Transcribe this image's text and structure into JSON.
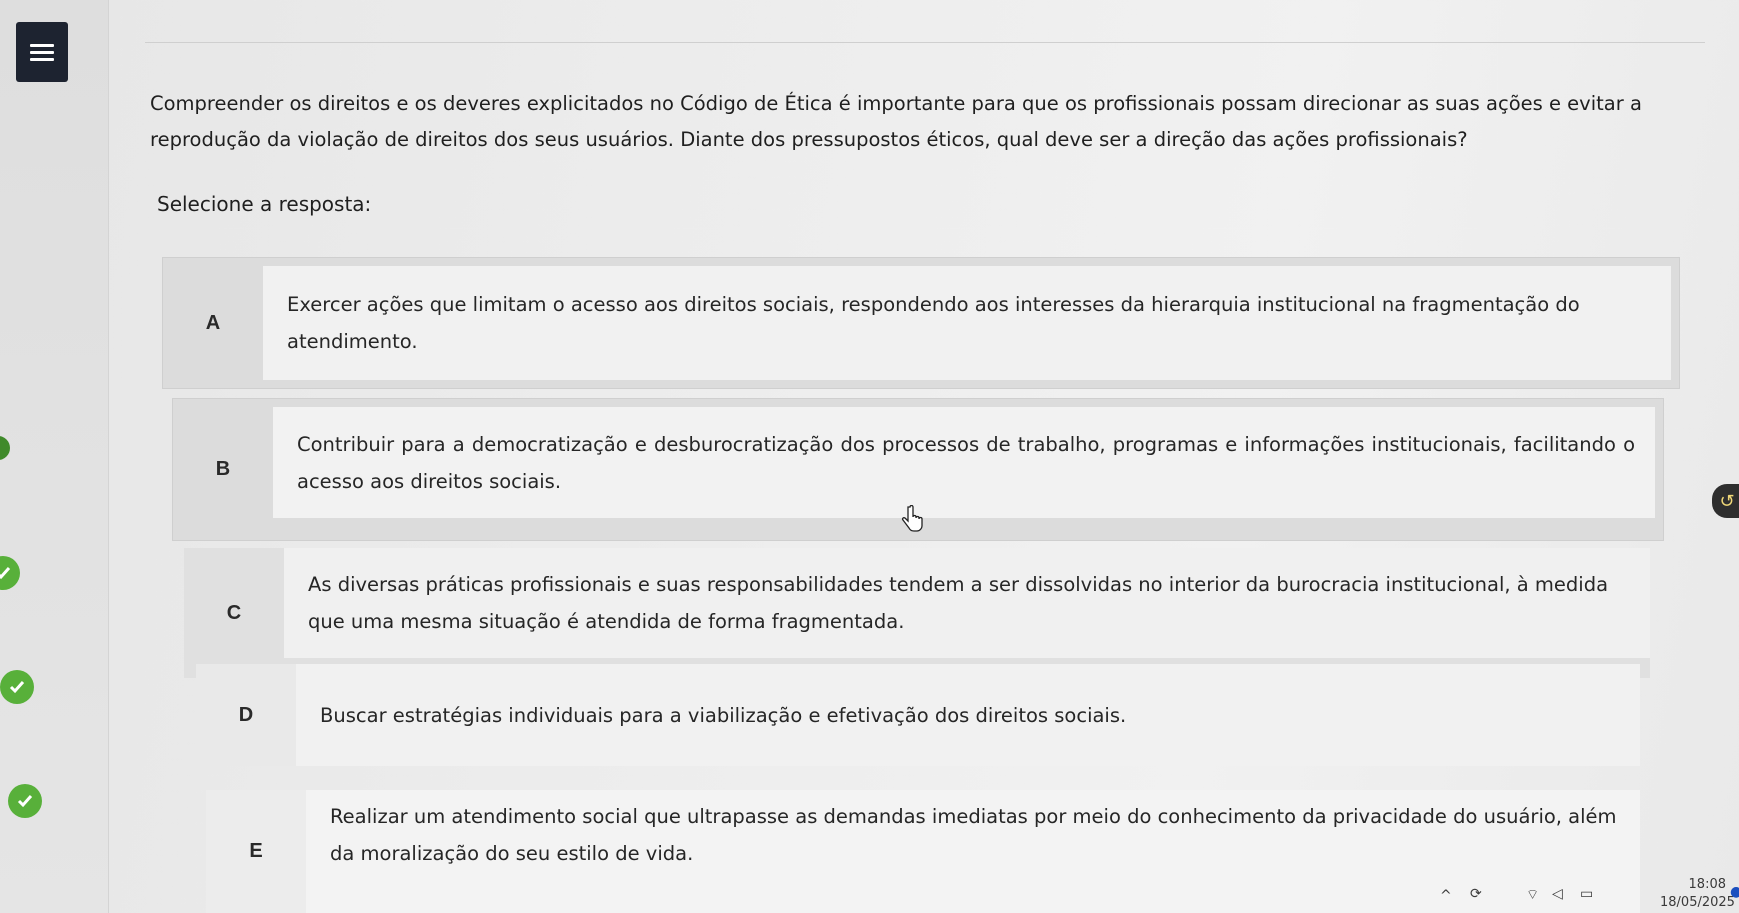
{
  "question": {
    "text": "Compreender os direitos e os deveres explicitados no Código de Ética é importante para que os profissionais possam direcionar as suas ações e evitar a reprodução da violação de direitos dos seus usuários. Diante dos pressupostos éticos, qual deve ser a direção das ações profissionais?",
    "select_label": "Selecione a resposta:"
  },
  "options": [
    {
      "letter": "A",
      "text": "Exercer ações que limitam o acesso aos direitos sociais, respondendo aos interesses da hierarquia institucional na fragmentação do atendimento."
    },
    {
      "letter": "B",
      "text": "Contribuir para a democratização e desburocratização dos processos de trabalho, programas e informações institucionais, facilitando o acesso aos direitos sociais."
    },
    {
      "letter": "C",
      "text": "As diversas práticas profissionais e suas responsabilidades tendem a ser dissolvidas no interior da burocracia institucional, à medida que uma mesma situação é atendida de forma fragmentada."
    },
    {
      "letter": "D",
      "text": "Buscar estratégias individuais para a viabilização e efetivação dos direitos sociais."
    },
    {
      "letter": "E",
      "text": "Realizar um atendimento social que ultrapasse as demandas imediatas por meio do conhecimento da privacidade do usuário, além da moralização do seu estilo de vida."
    }
  ],
  "icons": {
    "menu": "hamburger-menu-icon",
    "check": "check-circle-icon",
    "cursor": "hand-pointer-icon"
  },
  "colors": {
    "menu_bg": "#1d2330",
    "check_green": "#58b03a"
  },
  "taskbar": {
    "time": "18:08",
    "date": "18/05/2025"
  }
}
